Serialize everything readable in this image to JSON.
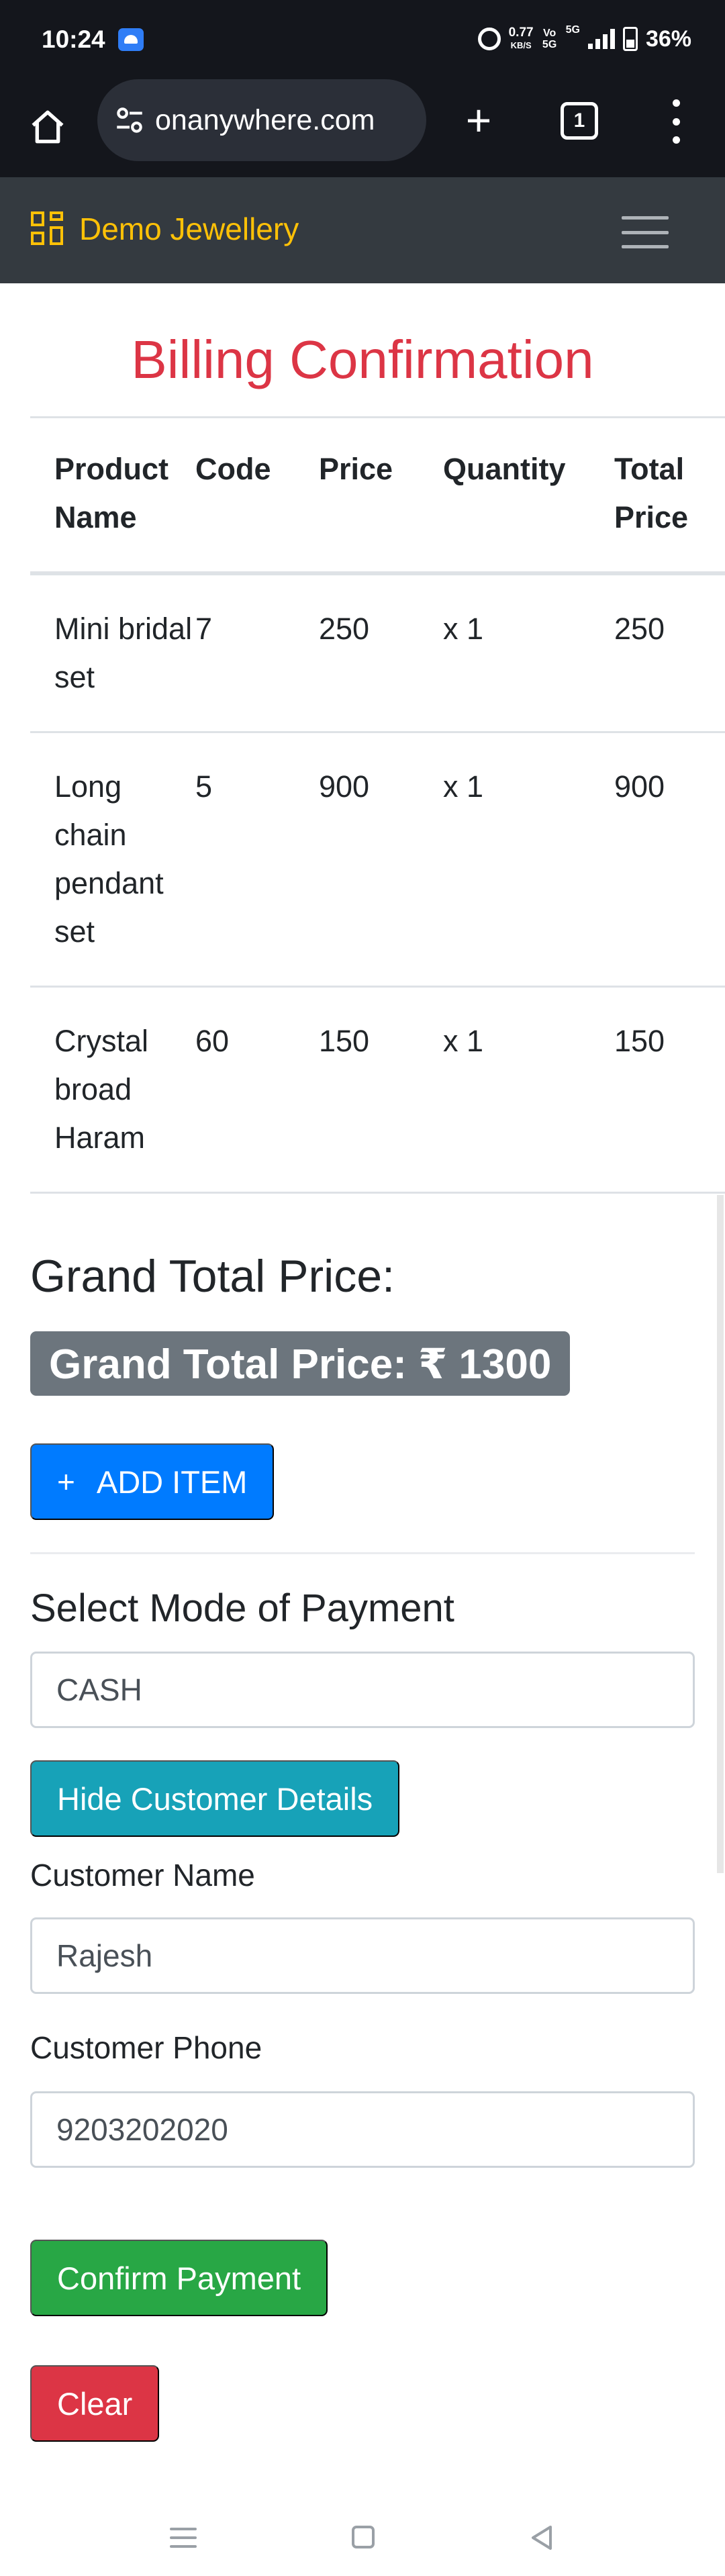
{
  "status_bar": {
    "time": "10:24",
    "net_speed_value": "0.77",
    "net_speed_unit": "KB/S",
    "volte_top": "Vo",
    "volte_bottom": "5G",
    "network": "5G",
    "battery": "36%"
  },
  "browser": {
    "url": "onanywhere.com",
    "tab_count": "1"
  },
  "navbar": {
    "brand": "Demo Jewellery"
  },
  "page": {
    "title": "Billing Confirmation"
  },
  "table": {
    "headers": [
      "Product Name",
      "Code",
      "Price",
      "Quantity",
      "Total Price"
    ],
    "rows": [
      {
        "name": "Mini bridal set",
        "code": "7",
        "price": "250",
        "quantity": "x 1",
        "total": "250"
      },
      {
        "name": "Long chain pendant set",
        "code": "5",
        "price": "900",
        "quantity": "x 1",
        "total": "900"
      },
      {
        "name": "Crystal broad Haram",
        "code": "60",
        "price": "150",
        "quantity": "x 1",
        "total": "150"
      }
    ]
  },
  "summary": {
    "heading": "Grand Total Price:",
    "badge": "Grand Total Price: ₹ 1300"
  },
  "actions": {
    "add_item_icon": "+",
    "add_item": "ADD ITEM",
    "hide_customer": "Hide Customer Details",
    "confirm_payment": "Confirm Payment",
    "clear": "Clear"
  },
  "payment": {
    "label": "Select Mode of Payment",
    "mode": "CASH"
  },
  "customer": {
    "name_label": "Customer Name",
    "name_value": "Rajesh",
    "phone_label": "Customer Phone",
    "phone_value": "9203202020"
  },
  "colors": {
    "title": "#dc3545",
    "brand": "#ffc107",
    "navbar": "#343a40",
    "add_button": "#007bff",
    "hide_button": "#17a2b8",
    "confirm_button": "#28a745",
    "clear_button": "#dc3545",
    "badge": "#6c757d"
  }
}
